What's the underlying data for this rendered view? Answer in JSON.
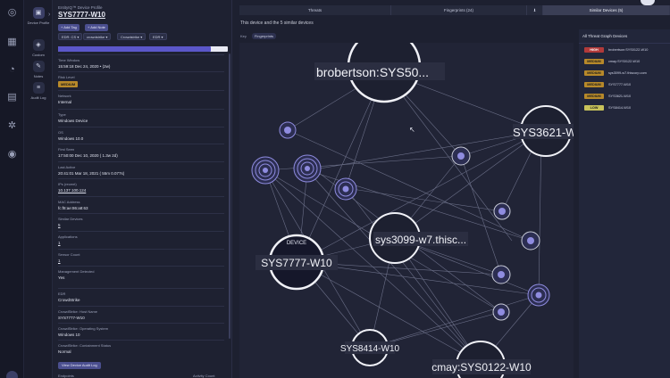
{
  "nav_rail": [
    "home-icon",
    "grid-icon",
    "chart-icon",
    "chat-icon",
    "gear-icon",
    "user-icon"
  ],
  "secondary_nav": {
    "items": [
      {
        "label": "Device Profile",
        "icon": "device-icon"
      },
      {
        "label": "Custom",
        "icon": "custom-icon"
      },
      {
        "label": "Notes",
        "icon": "notes-icon"
      },
      {
        "label": "Audit Log",
        "icon": "audit-icon"
      }
    ]
  },
  "device": {
    "header": "EntityIQ™ Device Profile",
    "title": "SYS7777-W10",
    "add_tag": "+ Add Tag",
    "add_note": "+ Add Note",
    "tags": [
      "EDR: CS ▾",
      "crowdstrike ▾",
      "Crowdstrike ▾",
      "EDR ▾"
    ],
    "progress_fraction": 0.9,
    "fields": {
      "time_window_label": "Time Window",
      "time_window_value": "15:59:18   Dec 24, 2020   • (2w)",
      "risk_label": "Risk Level",
      "risk_value": "MEDIUM",
      "network_label": "Network",
      "network_value": "Internal",
      "type_label": "Type",
      "type_value": "Windows Device",
      "os_label": "OS",
      "os_value": "Windows   10.0",
      "first_seen_label": "First Seen",
      "first_seen_value": "17:50:00   Dec 10, 2020  ( 1.3w 2d)",
      "last_active_label": "Last Active",
      "last_active_value": "20:41:01   Mar 18, 2021  ( 55m 0.077s)",
      "ips_label": "IPs (recent)",
      "ips_value": "10.137.100.124",
      "mac_label": "MAC Address",
      "mac_value": "fc:f8:ae:86:a8:63",
      "similar_label": "Similar Devices",
      "similar_value": "5",
      "applications_label": "Applications",
      "applications_value": "1",
      "sensor_label": "Sensor Count",
      "sensor_value": "1",
      "mgmt_label": "Management Detected",
      "mgmt_value": "Yes",
      "edr_label": "EDR",
      "edr_value": "CrowdStrike",
      "cs_host_label": "CrowdStrike: Host Name",
      "cs_host_value": "SYS7777-W10",
      "cs_os_label": "CrowdStrike: Operating System",
      "cs_os_value": "Windows 10",
      "cs_cont_label": "CrowdStrike: Containment Status",
      "cs_cont_value": "Normal"
    },
    "audit_button": "View Device Audit Log",
    "footer_left": "Endpoints",
    "footer_right": "Activity Count"
  },
  "tabs": [
    "Threats",
    "Fingerprints (24)",
    "⬇",
    "Similar Devices (5)"
  ],
  "subtitle": "This device and the 5 similar devices",
  "key_label": "Key",
  "key_chip": "Fingerprints",
  "graph": {
    "labels": {
      "brobertson": "brobertson:SYS50...",
      "sys3621": "SYS3621-W1",
      "sys3099": "sys3099-w7.thisc...",
      "device_small": "DEVICE",
      "device_main": "SYS7777-W10",
      "sys8414": "SYS8414-W10",
      "cmay": "cmay:SYS0122-W10"
    }
  },
  "threat_list": {
    "header": "All Threat Graph Devices",
    "rows": [
      {
        "level": "HIGH",
        "name": "brobertson:SYS0122-W10"
      },
      {
        "level": "MEDIUM",
        "name": "cmay:SYS0122-W10"
      },
      {
        "level": "MEDIUM",
        "name": "sys3099-w7.thiscorp.com"
      },
      {
        "level": "MEDIUM",
        "name": "SYS7777-W10"
      },
      {
        "level": "MEDIUM",
        "name": "SYS3621-W10"
      },
      {
        "level": "LOW",
        "name": "SYS8414-W10"
      }
    ]
  },
  "colors": {
    "accent": "#5b57c9",
    "medium": "#b7892a",
    "high": "#b23a3a",
    "low": "#c8c25a",
    "node_ring": "#8f8ce0"
  }
}
